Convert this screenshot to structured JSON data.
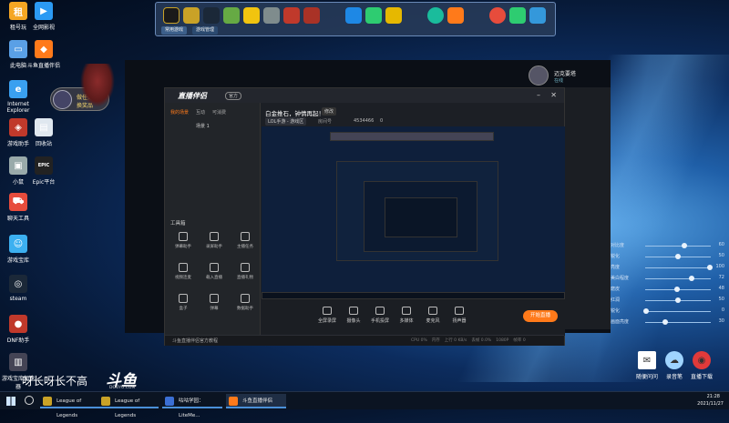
{
  "desktop_icons": [
    {
      "label": "租号玩",
      "color": "#f5a623",
      "glyph": "租"
    },
    {
      "label": "全网影视",
      "color": "#2b9af3",
      "glyph": "▶"
    },
    {
      "label": "此电脑",
      "color": "#5aa0e6",
      "glyph": "▭"
    },
    {
      "label": "斗鱼直播伴侣",
      "color": "#ff7a1a",
      "glyph": "◆"
    },
    {
      "label": "Internet Explorer",
      "color": "#3aa0f0",
      "glyph": "e"
    },
    {
      "label": "回收站",
      "color": "#dfe7ef",
      "glyph": "▤"
    },
    {
      "label": "游戏助手",
      "color": "#c0392b",
      "glyph": "◈"
    },
    {
      "label": "小鼠",
      "color": "#9aa",
      "glyph": "▣"
    },
    {
      "label": "Epic平台",
      "color": "#222",
      "glyph": "EPIC"
    },
    {
      "label": "聊天工具",
      "color": "#e74c3c",
      "glyph": "⛟"
    },
    {
      "label": "游戏宝库",
      "color": "#3cb0f0",
      "glyph": "☺"
    },
    {
      "label": "steam",
      "color": "#1b2838",
      "glyph": "◎"
    },
    {
      "label": "DNF助手",
      "color": "#c0392b",
      "glyph": "●"
    },
    {
      "label": "游戏宝库加速器",
      "color": "#445",
      "glyph": "▥"
    }
  ],
  "overlay_widget": {
    "line1": "做任务",
    "line2": "换奖品"
  },
  "dock": {
    "tabs": [
      "常用游戏",
      "游戏管理"
    ]
  },
  "streaming_app": {
    "logo": "直播伴侣",
    "badge": "官方",
    "left_tabs": [
      "我的场景",
      "互动",
      "可消费"
    ],
    "scene_item": "场景 1",
    "tools_title": "工具箱",
    "tools": [
      "弹幕助手",
      "录屏助手",
      "主播任务",
      "视频连麦",
      "载入直播",
      "直播礼物",
      "盒子",
      "弹幕",
      "数据助手"
    ],
    "notice": "斗鱼直播伴侣官方教程",
    "stream_title": "白金推石，钟情再起！",
    "stream_edit": "修改",
    "category": "LOL手游 - 游戏区",
    "room_label": "房间号",
    "room_number": "4534466",
    "viewers": "0",
    "controls": [
      "全屏录屏",
      "摄像头",
      "手机投屏",
      "多媒体",
      "麦克风",
      "扬声器"
    ],
    "live_button": "开始直播",
    "status": [
      "CPU 0%",
      "内存",
      "上行 0 KB/s",
      "丢帧 0.0%",
      "1080P",
      "帧率 0"
    ]
  },
  "right_panel": {
    "user": "迈克要塔",
    "status": "在线"
  },
  "sliders": [
    {
      "label": "对比度",
      "value": "60",
      "fraction": 0.6
    },
    {
      "label": "锐化",
      "value": "50",
      "fraction": 0.5
    },
    {
      "label": "亮度",
      "value": "100",
      "fraction": 1.0
    },
    {
      "label": "美白程度",
      "value": "72",
      "fraction": 0.72
    },
    {
      "label": "磨皮",
      "value": "48",
      "fraction": 0.48
    },
    {
      "label": "红润",
      "value": "50",
      "fraction": 0.5
    },
    {
      "label": "锐化",
      "value": "0",
      "fraction": 0.0
    },
    {
      "label": "画面亮度",
      "value": "30",
      "fraction": 0.3
    }
  ],
  "bottom_right_icons": [
    {
      "label": "随便问问",
      "glyph": "✉"
    },
    {
      "label": "录音笔",
      "glyph": "☁"
    },
    {
      "label": "直播下载",
      "glyph": "◉"
    }
  ],
  "watermark": {
    "text": "呀长呀长不高",
    "logo": "斗鱼",
    "sub": "DOUYU.COM"
  },
  "taskbar": {
    "items": [
      "League of Legends",
      "League of Legends",
      "咕咕学园：LiteMe...",
      "斗鱼直播伴侣"
    ],
    "time": "21:28",
    "date": "2021/11/27"
  }
}
